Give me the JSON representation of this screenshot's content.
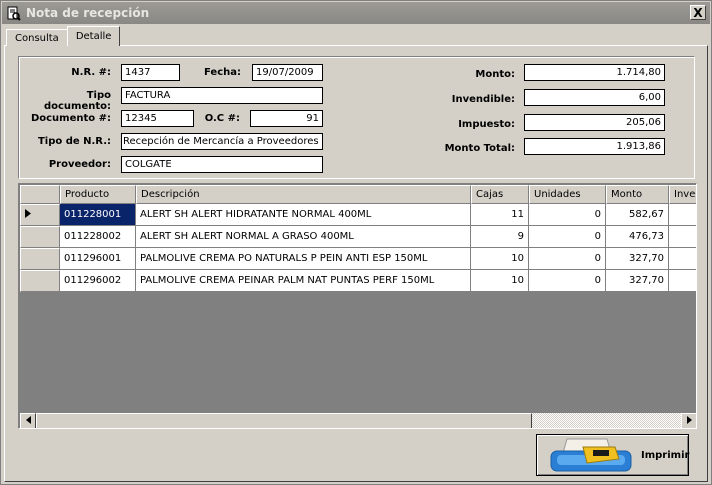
{
  "window": {
    "title": "Nota de recepción",
    "close_glyph": "X"
  },
  "tabs": [
    {
      "label": "Consulta",
      "active": false
    },
    {
      "label": "Detalle",
      "active": true
    }
  ],
  "header": {
    "nr_label": "N.R. #:",
    "nr_value": "1437",
    "fecha_label": "Fecha:",
    "fecha_value": "19/07/2009",
    "tipo_doc_label": "Tipo documento:",
    "tipo_doc_value": "FACTURA",
    "documento_label": "Documento #:",
    "documento_value": "12345",
    "oc_label": "O.C #:",
    "oc_value": "91",
    "tipo_nr_label": "Tipo de N.R.:",
    "tipo_nr_value": "Recepción de Mercancía a Proveedores",
    "proveedor_label": "Proveedor:",
    "proveedor_value": "COLGATE",
    "monto_label": "Monto:",
    "monto_value": "1.714,80",
    "invendible_label": "Invendible:",
    "invendible_value": "6,00",
    "impuesto_label": "Impuesto:",
    "impuesto_value": "205,06",
    "monto_total_label": "Monto Total:",
    "monto_total_value": "1.913,86"
  },
  "grid": {
    "columns": [
      "Producto",
      "Descripción",
      "Cajas",
      "Unidades",
      "Monto",
      "Inven"
    ],
    "rows": [
      {
        "producto": "011228001",
        "descripcion": "ALERT SH ALERT HIDRATANTE NORMAL        400ML",
        "cajas": "11",
        "unidades": "0",
        "monto": "582,67",
        "current": true
      },
      {
        "producto": "011228002",
        "descripcion": "ALERT SH ALERT NORMAL A GRASO        400ML",
        "cajas": "9",
        "unidades": "0",
        "monto": "476,73",
        "current": false
      },
      {
        "producto": "011296001",
        "descripcion": "PALMOLIVE CREMA PO NATURALS P PEIN ANTI ESP 150ML",
        "cajas": "10",
        "unidades": "0",
        "monto": "327,70",
        "current": false
      },
      {
        "producto": "011296002",
        "descripcion": "PALMOLIVE CREMA PEINAR PALM NAT PUNTAS PERF 150ML",
        "cajas": "10",
        "unidades": "0",
        "monto": "327,70",
        "current": false
      }
    ]
  },
  "actions": {
    "print_label": "Imprimir"
  },
  "icons": {
    "title": "notepad-magnifier-icon",
    "row_pointer": "row-pointer-icon",
    "scroll_left": "scroll-left-arrow-icon",
    "scroll_right": "scroll-right-arrow-icon",
    "print": "printer-icon"
  },
  "colors": {
    "titlebar": "#8a8884",
    "selection": "#0a246a",
    "grid_empty": "#808080",
    "printer_blue": "#2a7fd4",
    "printer_yellow": "#f0c020"
  }
}
